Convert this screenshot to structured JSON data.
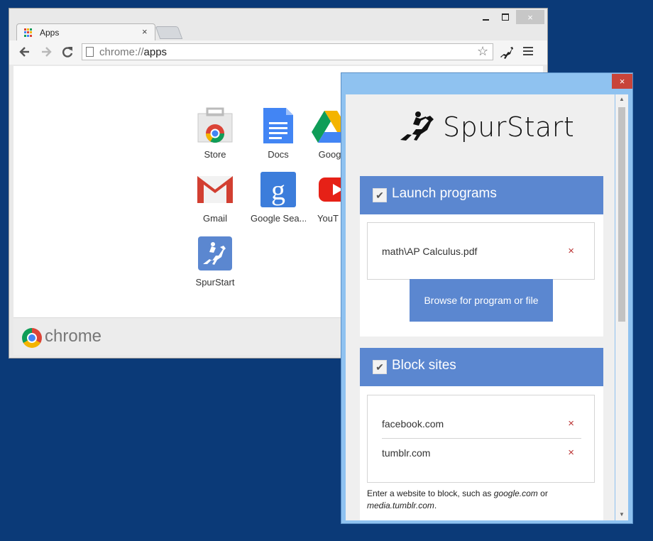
{
  "chrome": {
    "tab_title": "Apps",
    "url_scheme": "chrome://",
    "url_path": "apps",
    "close_glyph": "×",
    "footer_word": "chrome",
    "apps": [
      {
        "label": "Store",
        "icon": "store-icon"
      },
      {
        "label": "Docs",
        "icon": "docs-icon"
      },
      {
        "label": "Googl",
        "icon": "drive-icon"
      },
      {
        "label": "Gmail",
        "icon": "gmail-icon"
      },
      {
        "label": "Google Sea...",
        "icon": "google-search-icon"
      },
      {
        "label": "YouT",
        "icon": "youtube-icon"
      },
      {
        "label": "SpurStart",
        "icon": "spurstart-app-icon"
      }
    ]
  },
  "spurstart": {
    "brand": "SpurStart",
    "close_glyph": "×",
    "launch": {
      "title": "Launch programs",
      "checked": true,
      "items": [
        "math\\AP Calculus.pdf"
      ],
      "browse_label": "Browse for program or file"
    },
    "block": {
      "title": "Block sites",
      "checked": true,
      "items": [
        "facebook.com",
        "tumblr.com"
      ]
    },
    "hint": {
      "prefix": "Enter a website to block, such as ",
      "example1": "google.com",
      "middle": " or ",
      "example2": "media.tumblr.com",
      "suffix": "."
    },
    "remove_glyph": "×",
    "check_glyph": "✔",
    "accent_color": "#5b87d0"
  },
  "desktop_color": "#0b3a78"
}
